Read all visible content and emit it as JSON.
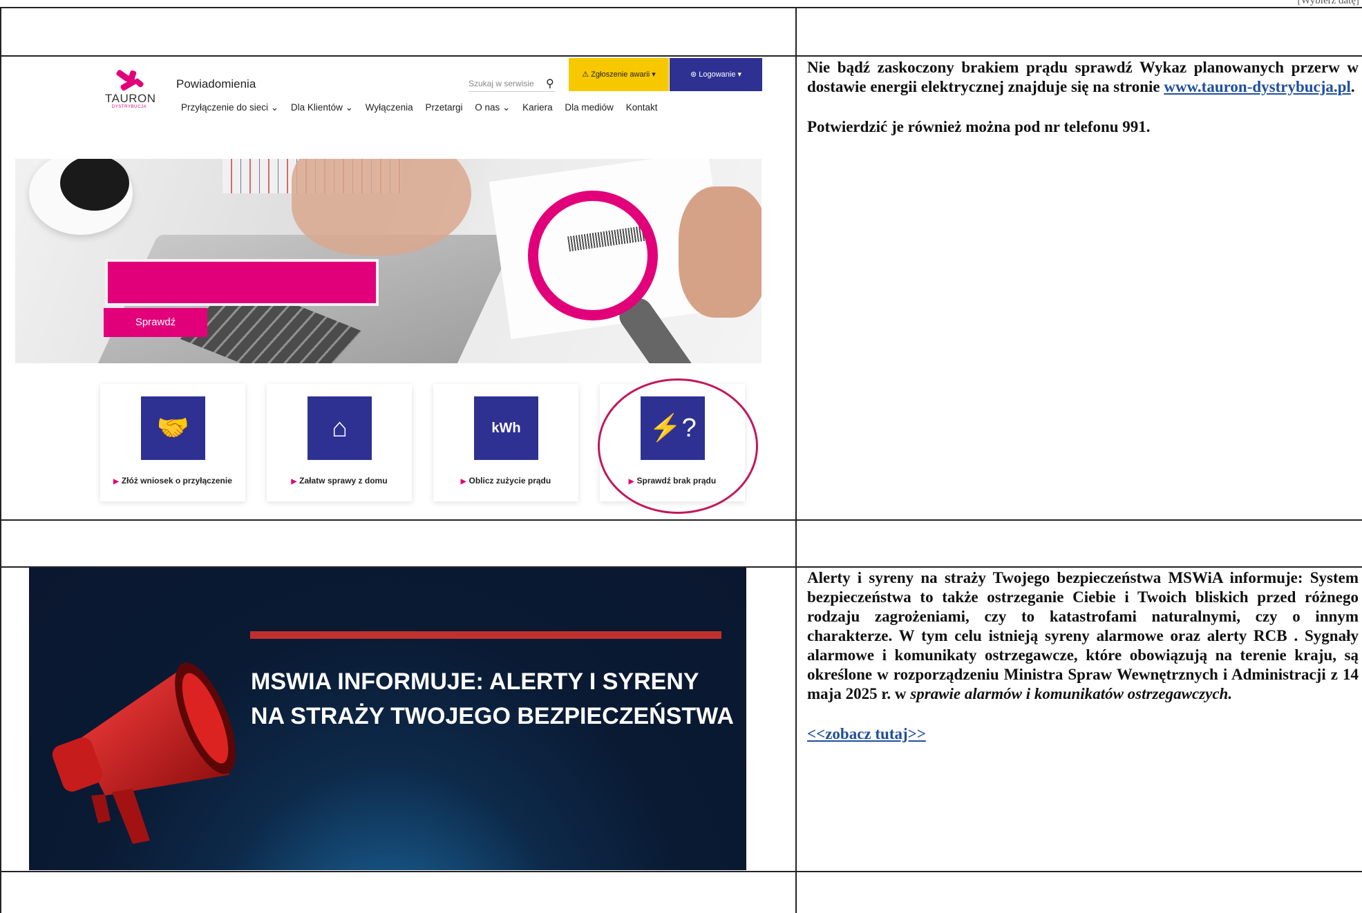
{
  "date_placeholder": "[Wybierz datę]",
  "row1": {
    "text_intro": "Nie bądź zaskoczony brakiem prądu sprawdź ",
    "text_bold2": "Wykaz planowanych przerw w dostawie energii elektrycznej znajduje się na stronie ",
    "link": "www.tauron-dystrybucja.pl",
    "text_end": ".",
    "text_phone": "Potwierdzić je również można pod nr telefonu 991."
  },
  "tauron": {
    "logo": "TAURON",
    "logo_sub": "DYSTRYBUCJA",
    "title": "Powiadomienia",
    "search_placeholder": "Szukaj w serwisie",
    "btn_awaria": "Zgłoszenie awarii",
    "btn_login": "Logowanie",
    "nav": [
      "Przyłączenie do sieci ⌄",
      "Dla Klientów ⌄",
      "Wyłączenia",
      "Przetargi",
      "O nas ⌄",
      "Kariera",
      "Dla mediów",
      "Kontakt"
    ],
    "hero_button": "Sprawdź",
    "tiles": [
      {
        "label": "Złóż wniosek o przyłączenie",
        "icon": "handshake-lightbulb-icon"
      },
      {
        "label": "Załatw sprawy z domu",
        "icon": "meter-house-icon"
      },
      {
        "label": "Oblicz zużycie prądu",
        "icon": "kwh-plug-icon"
      },
      {
        "label": "Sprawdź brak prądu",
        "icon": "power-pylon-question-icon"
      }
    ]
  },
  "row2": {
    "banner_headline_1": "MSWIA INFORMUJE: ALERTY I SYRENY",
    "banner_headline_2": "NA STRAŻY TWOJEGO BEZPIECZEŃSTWA",
    "text_main": "Alerty i syreny na straży Twojego bezpieczeństwa MSWiA informuje: System bezpieczeństwa to także ostrzeganie Ciebie i Twoich bliskich przed różnego rodzaju zagrożeniami, czy to katastrofami naturalnymi, czy o innym charakterze. W tym celu istnieją syreny alarmowe oraz alerty RCB . Sygnały alarmowe i komunikaty ostrzegawcze, które obowiązują na terenie kraju, są określone w rozporządzeniu Ministra Spraw Wewnętrznych i Administracji z 14 maja 2025 r. w ",
    "text_italic": "sprawie alarmów i komunikatów ostrzegawczych.",
    "link": "<<zobacz tutaj>>"
  }
}
